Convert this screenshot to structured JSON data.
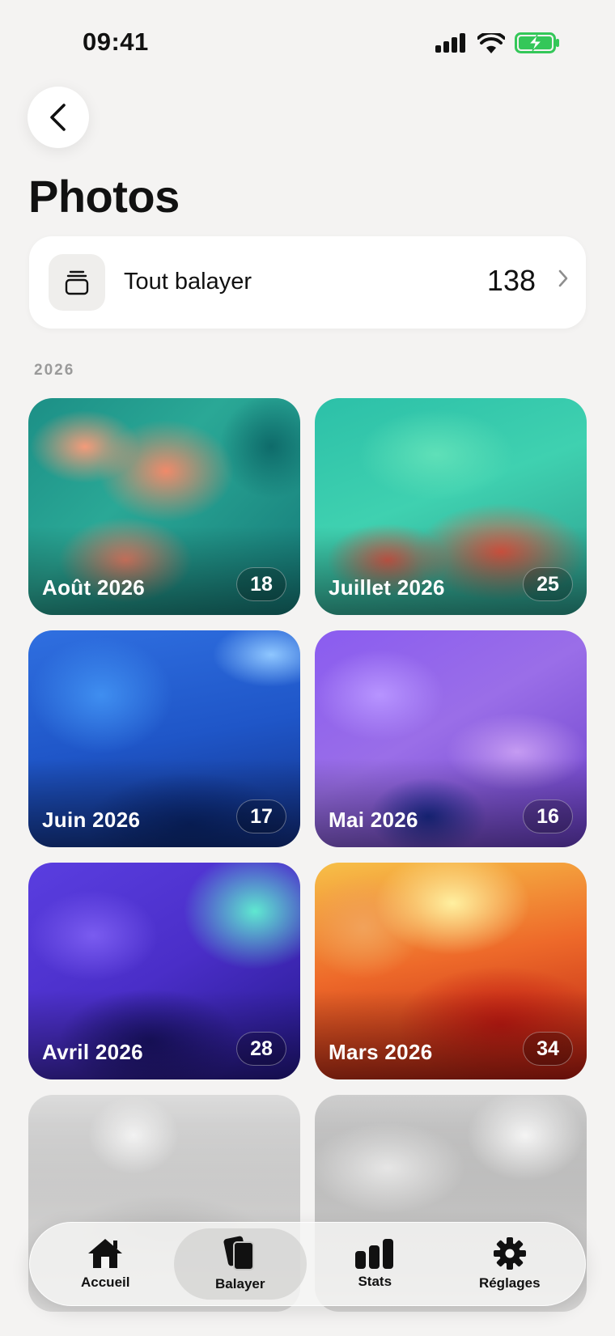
{
  "status_bar": {
    "time": "09:41"
  },
  "header": {
    "title": "Photos"
  },
  "sweep_all": {
    "label": "Tout balayer",
    "count": "138"
  },
  "section": {
    "year": "2026"
  },
  "months": [
    {
      "label": "Août 2026",
      "count": "18"
    },
    {
      "label": "Juillet 2026",
      "count": "25"
    },
    {
      "label": "Juin 2026",
      "count": "17"
    },
    {
      "label": "Mai 2026",
      "count": "16"
    },
    {
      "label": "Avril 2026",
      "count": "28"
    },
    {
      "label": "Mars 2026",
      "count": "34"
    }
  ],
  "tab_bar": {
    "items": [
      {
        "label": "Accueil",
        "icon": "house-icon"
      },
      {
        "label": "Balayer",
        "icon": "cards-icon",
        "active": true
      },
      {
        "label": "Stats",
        "icon": "bar-chart-icon"
      },
      {
        "label": "Réglages",
        "icon": "gear-icon"
      }
    ]
  },
  "colors": {
    "background": "#f4f3f2",
    "card": "#ffffff",
    "text": "#111111",
    "battery_green": "#34c759"
  }
}
